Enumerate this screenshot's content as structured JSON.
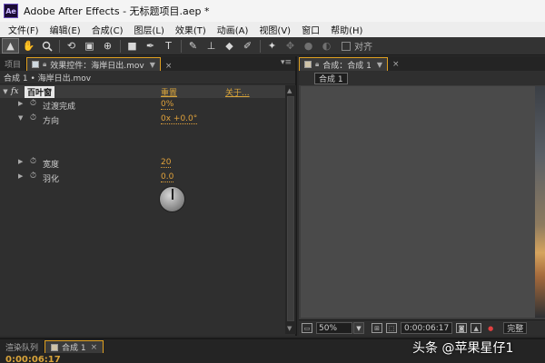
{
  "titlebar": {
    "app_icon": "Ae",
    "title": "Adobe After Effects - 无标题项目.aep *"
  },
  "menu": [
    "文件(F)",
    "编辑(E)",
    "合成(C)",
    "图层(L)",
    "效果(T)",
    "动画(A)",
    "视图(V)",
    "窗口",
    "帮助(H)"
  ],
  "toolbar": {
    "tools": [
      {
        "icon": "selection-tool-icon",
        "glyph": "▲",
        "active": true
      },
      {
        "icon": "hand-tool-icon",
        "glyph": "✋"
      },
      {
        "icon": "zoom-tool-icon",
        "glyph": "🔍"
      },
      {
        "icon": "rotate-tool-icon",
        "glyph": "⟲"
      },
      {
        "icon": "camera-tool-icon",
        "glyph": "▣"
      },
      {
        "icon": "pan-behind-tool-icon",
        "glyph": "⊕"
      },
      {
        "icon": "rectangle-tool-icon",
        "glyph": "■"
      },
      {
        "icon": "pen-tool-icon",
        "glyph": "✒"
      },
      {
        "icon": "type-tool-icon",
        "glyph": "T"
      },
      {
        "icon": "brush-tool-icon",
        "glyph": "✎"
      },
      {
        "icon": "clone-stamp-tool-icon",
        "glyph": "⊥"
      },
      {
        "icon": "eraser-tool-icon",
        "glyph": "◆"
      },
      {
        "icon": "roto-brush-tool-icon",
        "glyph": "✐"
      },
      {
        "icon": "puppet-pin-tool-icon",
        "glyph": "✦"
      }
    ],
    "snap_label": "对齐"
  },
  "left_panel": {
    "tabs": [
      {
        "label": "项目",
        "active": false
      },
      {
        "label": "效果控件：海岸日出.mov",
        "active": true
      }
    ],
    "breadcrumb": "合成 1 • 海岸日出.mov",
    "effect": {
      "name": "百叶窗",
      "reset_label": "重置",
      "about_label": "关于..."
    },
    "properties": [
      {
        "label": "过渡完成",
        "value": "0%"
      },
      {
        "label": "方向",
        "value": "0x +0.0°"
      },
      {
        "label": "宽度",
        "value": "20"
      },
      {
        "label": "羽化",
        "value": "0.0"
      }
    ]
  },
  "right_panel": {
    "tab_label": "合成：合成 1",
    "comp_chip": "合成 1",
    "viewer_bar": {
      "zoom": "50%",
      "timecode": "0:00:06:17",
      "resolution": "完整"
    }
  },
  "bottom": {
    "tabs": [
      {
        "label": "渲染队列",
        "active": false
      },
      {
        "label": "合成 1",
        "active": true
      }
    ],
    "timecode": "0:00:06:17"
  },
  "watermark": "头条 @苹果星仔1"
}
